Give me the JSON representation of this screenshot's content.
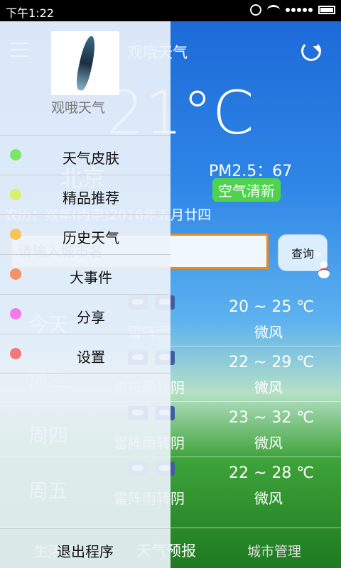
{
  "status_bar": {
    "time": "下午1:22",
    "icons": [
      "alarm-icon",
      "wifi-icon",
      "signal-icon",
      "battery-icon"
    ]
  },
  "header": {
    "title": "观哦天气"
  },
  "current": {
    "temperature": "21°C",
    "city": "北京",
    "pm25": "PM2.5：67",
    "air_quality": "空气清新",
    "lunar_date": "农历：猴年(丙申)2016年五月廿四"
  },
  "search": {
    "placeholder": "请输入城市名",
    "button": "查询"
  },
  "forecast": [
    {
      "day": "今天",
      "desc": "雷阵雨",
      "range": "20 ~ 25 ℃",
      "wind": "微风"
    },
    {
      "day": "周三",
      "desc": "雷阵雨转阴",
      "range": "22 ~ 29 ℃",
      "wind": "微风"
    },
    {
      "day": "周四",
      "desc": "雷阵雨转阴",
      "range": "23 ~ 32 ℃",
      "wind": "微风"
    },
    {
      "day": "周五",
      "desc": "雷阵雨转阴",
      "range": "22 ~ 28 ℃",
      "wind": "微风"
    }
  ],
  "bottom_nav": {
    "tab1": "生活",
    "tab2": "天气预报",
    "tab3": "城市管理"
  },
  "drawer": {
    "title": "观哦天气",
    "items": [
      {
        "label": "天气皮肤",
        "color": "#7ee36b"
      },
      {
        "label": "精品推荐",
        "color": "#d9f06a"
      },
      {
        "label": "历史天气",
        "color": "#f7c35a"
      },
      {
        "label": "大事件",
        "color": "#f4906a"
      },
      {
        "label": "分享",
        "color": "#f47ae8"
      },
      {
        "label": "设置",
        "color": "#f07a7a"
      }
    ],
    "exit": "退出程序"
  },
  "colors": {
    "accent": "#f08a1a",
    "air_good": "#4fd34e"
  }
}
